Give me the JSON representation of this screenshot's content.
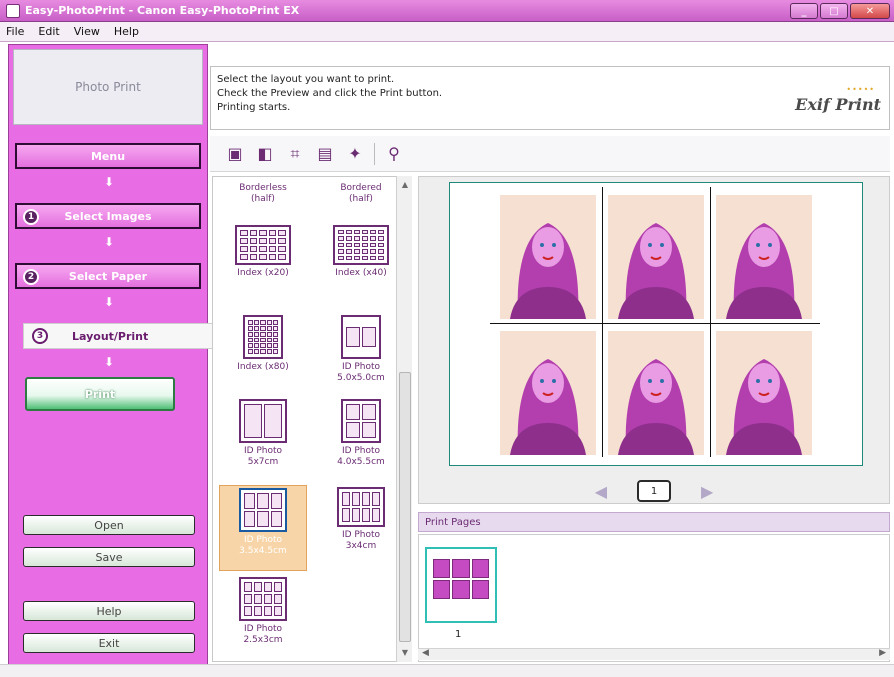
{
  "window": {
    "title": "Easy-PhotoPrint - Canon Easy-PhotoPrint EX",
    "minimize_label": "_",
    "maximize_label": "□",
    "close_label": "✕"
  },
  "menu": [
    "File",
    "Edit",
    "View",
    "Help"
  ],
  "sidebar": {
    "mode_title": "Photo Print",
    "steps": [
      {
        "label": "Menu",
        "number": ""
      },
      {
        "label": "Select Images",
        "number": "1"
      },
      {
        "label": "Select Paper",
        "number": "2"
      },
      {
        "label": "Layout/Print",
        "number": "3"
      }
    ],
    "print_label": "Print",
    "open_label": "Open",
    "save_label": "Save",
    "help_label": "Help",
    "exit_label": "Exit"
  },
  "info": {
    "line1": "Select the layout you want to print.",
    "line2": "Check the Preview and click the Print button.",
    "line3": "Printing starts.",
    "brand": "Exif Print"
  },
  "layouts": [
    {
      "label1": "Borderless",
      "label2": "(half)"
    },
    {
      "label1": "Bordered",
      "label2": "(half)"
    },
    {
      "label1": "Index (x20)",
      "label2": ""
    },
    {
      "label1": "Index (x40)",
      "label2": ""
    },
    {
      "label1": "Index (x80)",
      "label2": ""
    },
    {
      "label1": "ID Photo",
      "label2": "5.0x5.0cm"
    },
    {
      "label1": "ID Photo",
      "label2": "5x7cm"
    },
    {
      "label1": "ID Photo",
      "label2": "4.0x5.5cm"
    },
    {
      "label1": "ID Photo",
      "label2": "3.5x4.5cm"
    },
    {
      "label1": "ID Photo",
      "label2": "3x4cm"
    },
    {
      "label1": "ID Photo",
      "label2": "2.5x3cm"
    }
  ],
  "preview": {
    "page_number": "1",
    "photo_count": 6
  },
  "pages_strip": {
    "header": "Print Pages",
    "thumb_number": "1"
  },
  "colors": {
    "accent": "#e86ce4",
    "frame": "#1f8a7a",
    "selected": "#f8d5a8"
  }
}
